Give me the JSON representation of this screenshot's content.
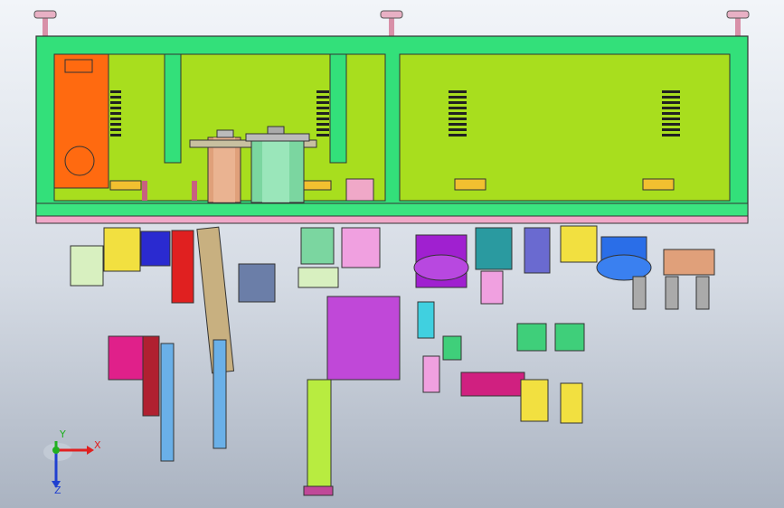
{
  "viewport": {
    "background_top": "#f2f5f9",
    "background_bottom": "#aab3c1"
  },
  "model": {
    "colors": {
      "frame": "#33e07a",
      "panel": "#a8de1e",
      "base_plate": "#f0a8c8",
      "orange_box": "#ff6a10",
      "copper": "#e0a07a",
      "green_pot": "#7bd6a0",
      "purple": "#a020d0",
      "blue": "#2a6ee8",
      "yellow": "#f2e040",
      "magenta": "#e0208a",
      "cyan": "#40d0e0"
    },
    "vent_icons": [
      "vent-left-1",
      "vent-left-2",
      "vent-right-1",
      "vent-right-2"
    ]
  },
  "triad": {
    "x_label": "X",
    "y_label": "Y",
    "z_label": "Z",
    "x_color": "#e02020",
    "y_color": "#20b020",
    "z_color": "#2040d0"
  }
}
